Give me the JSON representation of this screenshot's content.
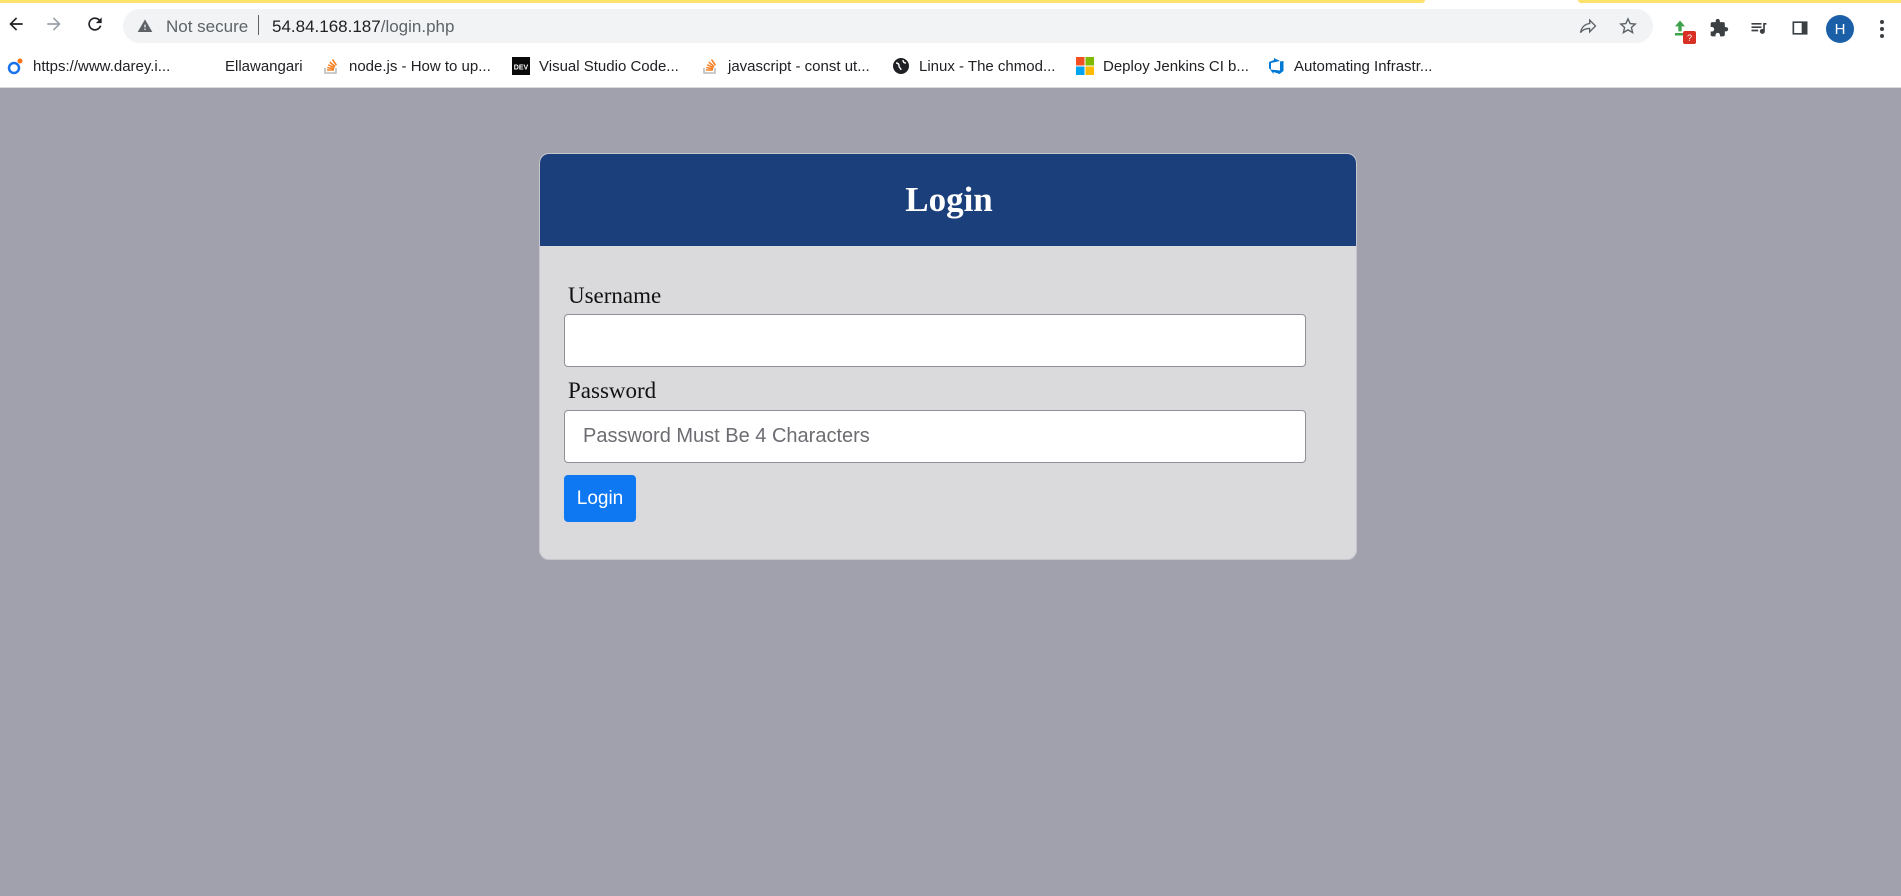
{
  "browser": {
    "security_label": "Not secure",
    "url_host": "54.84.168.187",
    "url_path": "/login.php",
    "avatar_letter": "H",
    "extension_badge": "?",
    "bookmarks": [
      {
        "label": "https://www.darey.i...",
        "icon": "darey-favicon"
      },
      {
        "label": "Ellawangari",
        "icon": "none"
      },
      {
        "label": "node.js - How to up...",
        "icon": "stackoverflow-favicon"
      },
      {
        "label": "Visual Studio Code...",
        "icon": "dev-favicon"
      },
      {
        "label": "javascript - const ut...",
        "icon": "stackoverflow-favicon"
      },
      {
        "label": "Linux - The chmod...",
        "icon": "globe-icon"
      },
      {
        "label": "Deploy Jenkins CI b...",
        "icon": "microsoft-favicon"
      },
      {
        "label": "Automating Infrastr...",
        "icon": "azure-devops-favicon"
      }
    ]
  },
  "login": {
    "title": "Login",
    "username_label": "Username",
    "username_value": "",
    "password_label": "Password",
    "password_placeholder": "Password Must Be 4 Characters",
    "submit_label": "Login"
  },
  "colors": {
    "page_bg": "#a1a1ad",
    "header_bg": "#1b3f7a",
    "card_bg": "#dad9db",
    "button_bg": "#0d78f2"
  }
}
